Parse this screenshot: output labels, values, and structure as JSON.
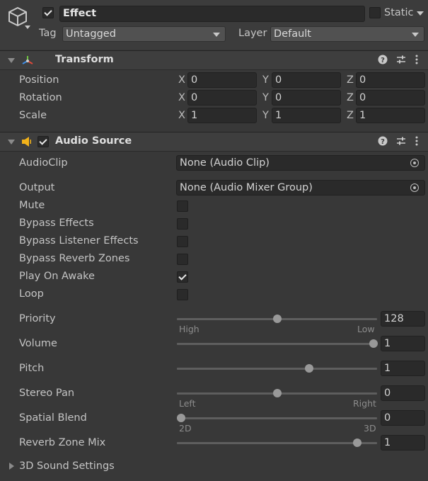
{
  "object": {
    "name": "Effect",
    "active": true,
    "static_label": "Static",
    "static_checked": false,
    "tag_label": "Tag",
    "tag_value": "Untagged",
    "layer_label": "Layer",
    "layer_value": "Default"
  },
  "transform": {
    "title": "Transform",
    "rows": [
      {
        "label": "Position",
        "x": "0",
        "y": "0",
        "z": "0"
      },
      {
        "label": "Rotation",
        "x": "0",
        "y": "0",
        "z": "0"
      },
      {
        "label": "Scale",
        "x": "1",
        "y": "1",
        "z": "1"
      }
    ],
    "axis": {
      "x": "X",
      "y": "Y",
      "z": "Z"
    }
  },
  "audio_source": {
    "title": "Audio Source",
    "enabled": true,
    "audio_clip": {
      "label": "AudioClip",
      "value": "None (Audio Clip)"
    },
    "output": {
      "label": "Output",
      "value": "None (Audio Mixer Group)"
    },
    "toggles": [
      {
        "label": "Mute",
        "checked": false
      },
      {
        "label": "Bypass Effects",
        "checked": false
      },
      {
        "label": "Bypass Listener Effects",
        "checked": false
      },
      {
        "label": "Bypass Reverb Zones",
        "checked": false
      },
      {
        "label": "Play On Awake",
        "checked": true
      },
      {
        "label": "Loop",
        "checked": false
      }
    ],
    "priority": {
      "label": "Priority",
      "value": "128",
      "fraction": 0.5,
      "min_label": "High",
      "max_label": "Low"
    },
    "volume": {
      "label": "Volume",
      "value": "1",
      "fraction": 1.0
    },
    "pitch": {
      "label": "Pitch",
      "value": "1",
      "fraction": 0.66
    },
    "stereo_pan": {
      "label": "Stereo Pan",
      "value": "0",
      "fraction": 0.5,
      "min_label": "Left",
      "max_label": "Right"
    },
    "spatial_blend": {
      "label": "Spatial Blend",
      "value": "0",
      "fraction": 0.0,
      "min_label": "2D",
      "max_label": "3D"
    },
    "reverb_zone_mix": {
      "label": "Reverb Zone Mix",
      "value": "1",
      "fraction": 0.9
    },
    "sound_settings": {
      "label": "3D Sound Settings"
    }
  },
  "icons": {
    "gameobject": "cube-icon",
    "transform": "transform-axes-icon",
    "audio": "speaker-icon",
    "help": "help-icon",
    "presets": "sliders-icon",
    "menu": "kebab-menu-icon"
  },
  "colors": {
    "background": "#383838",
    "field": "#2a2a2a",
    "header": "#3e3e3e",
    "audio_icon": "#f2b21a"
  }
}
